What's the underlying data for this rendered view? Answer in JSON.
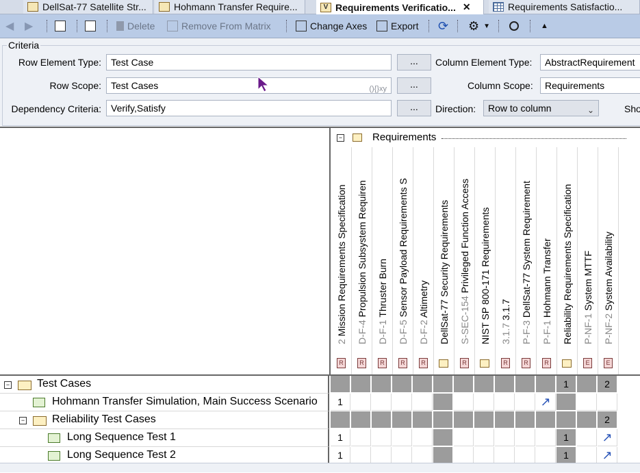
{
  "tabs": [
    {
      "label": "DellSat-77 Satellite Str...",
      "active": false
    },
    {
      "label": "Hohmann Transfer Require...",
      "active": false
    },
    {
      "label": "Requirements Verificatio...",
      "active": true,
      "icon_letter": "V"
    },
    {
      "label": "Requirements Satisfactio...",
      "active": false
    }
  ],
  "tab_close": "✕",
  "toolbar": {
    "delete_label": "Delete",
    "remove_label": "Remove From Matrix",
    "change_axes_label": "Change Axes",
    "export_label": "Export"
  },
  "criteria": {
    "title": "Criteria",
    "row_type_label": "Row Element Type:",
    "row_type_value": "Test Case",
    "row_scope_label": "Row Scope:",
    "row_scope_value": "Test Cases",
    "row_scope_hint": "(){}xy",
    "dependency_label": "Dependency Criteria:",
    "dependency_value": "Verify,Satisfy",
    "browse": "...",
    "col_type_label": "Column Element Type:",
    "col_type_value": "AbstractRequirement",
    "col_scope_label": "Column Scope:",
    "col_scope_value": "Requirements",
    "direction_label": "Direction:",
    "direction_value": "Row to column",
    "show_label": "Sho"
  },
  "matrix": {
    "root_column": "Requirements",
    "columns": [
      {
        "num": "2",
        "name": "Mission Requirements Specification",
        "badge": "R",
        "grey": false
      },
      {
        "num": "D-F-4",
        "name": "Propulsion Subsystem Requiren",
        "badge": "R",
        "grey": false
      },
      {
        "num": "D-F-1",
        "name": "Thruster Burn",
        "badge": "R",
        "grey": false
      },
      {
        "num": "D-F-5",
        "name": "Sensor Payload Requirements S",
        "badge": "R",
        "grey": false
      },
      {
        "num": "D-F-2",
        "name": "Altimetry",
        "badge": "R",
        "grey": false
      },
      {
        "num": "",
        "name": "DellSat-77 Security Requirements",
        "badge": "folder",
        "grey": true
      },
      {
        "num": "S-SEC-154",
        "name": "Privileged Function Access",
        "badge": "R",
        "grey": false
      },
      {
        "num": "",
        "name": "NIST SP 800-171 Requirements",
        "badge": "folder",
        "grey": false
      },
      {
        "num": "3.1.7",
        "name": "3.1.7",
        "badge": "R",
        "grey": false
      },
      {
        "num": "P-F-3",
        "name": "DellSat-77 System Requirement",
        "badge": "R",
        "grey": false
      },
      {
        "num": "P-F-1",
        "name": "Hohmann Transfer",
        "badge": "R",
        "grey": false
      },
      {
        "num": "",
        "name": "Reliability Requirements Specification",
        "badge": "folder",
        "grey": true
      },
      {
        "num": "P-NF-1",
        "name": "System MTTF",
        "badge": "E",
        "grey": false
      },
      {
        "num": "P-NF-2",
        "name": "System Availability",
        "badge": "E",
        "grey": false
      }
    ],
    "rows": [
      {
        "label": "Test Cases",
        "kind": "folder",
        "indent": 0,
        "toggle": "-",
        "cells": [
          "",
          "",
          "",
          "",
          "",
          "",
          "",
          "",
          "",
          "",
          "",
          "1",
          "",
          "2"
        ],
        "grey_row": true
      },
      {
        "label": "Hohmann Transfer Simulation, Main Success Scenario",
        "kind": "testcase",
        "indent": 1,
        "toggle": "",
        "cells": [
          "1",
          "",
          "",
          "",
          "",
          "",
          "",
          "",
          "",
          "",
          "↗",
          "",
          "",
          ""
        ],
        "grey_row": false
      },
      {
        "label": "Reliability Test Cases",
        "kind": "folder",
        "indent": 1,
        "toggle": "-",
        "cells": [
          "",
          "",
          "",
          "",
          "",
          "",
          "",
          "",
          "",
          "",
          "",
          "",
          "",
          "2"
        ],
        "grey_row": true
      },
      {
        "label": "Long Sequence Test 1",
        "kind": "testcase",
        "indent": 2,
        "toggle": "",
        "cells": [
          "1",
          "",
          "",
          "",
          "",
          "",
          "",
          "",
          "",
          "",
          "",
          "1",
          "",
          "↗"
        ],
        "grey_row": false
      },
      {
        "label": "Long Sequence Test 2",
        "kind": "testcase",
        "indent": 2,
        "toggle": "",
        "cells": [
          "1",
          "",
          "",
          "",
          "",
          "",
          "",
          "",
          "",
          "",
          "",
          "1",
          "",
          "↗"
        ],
        "grey_row": false
      }
    ]
  },
  "colors": {
    "toolbar_bg": "#b9cbe6",
    "grey_cell": "#9c9c9c",
    "arrow": "#2a55b8",
    "req_badge": "#f4d6d6"
  }
}
